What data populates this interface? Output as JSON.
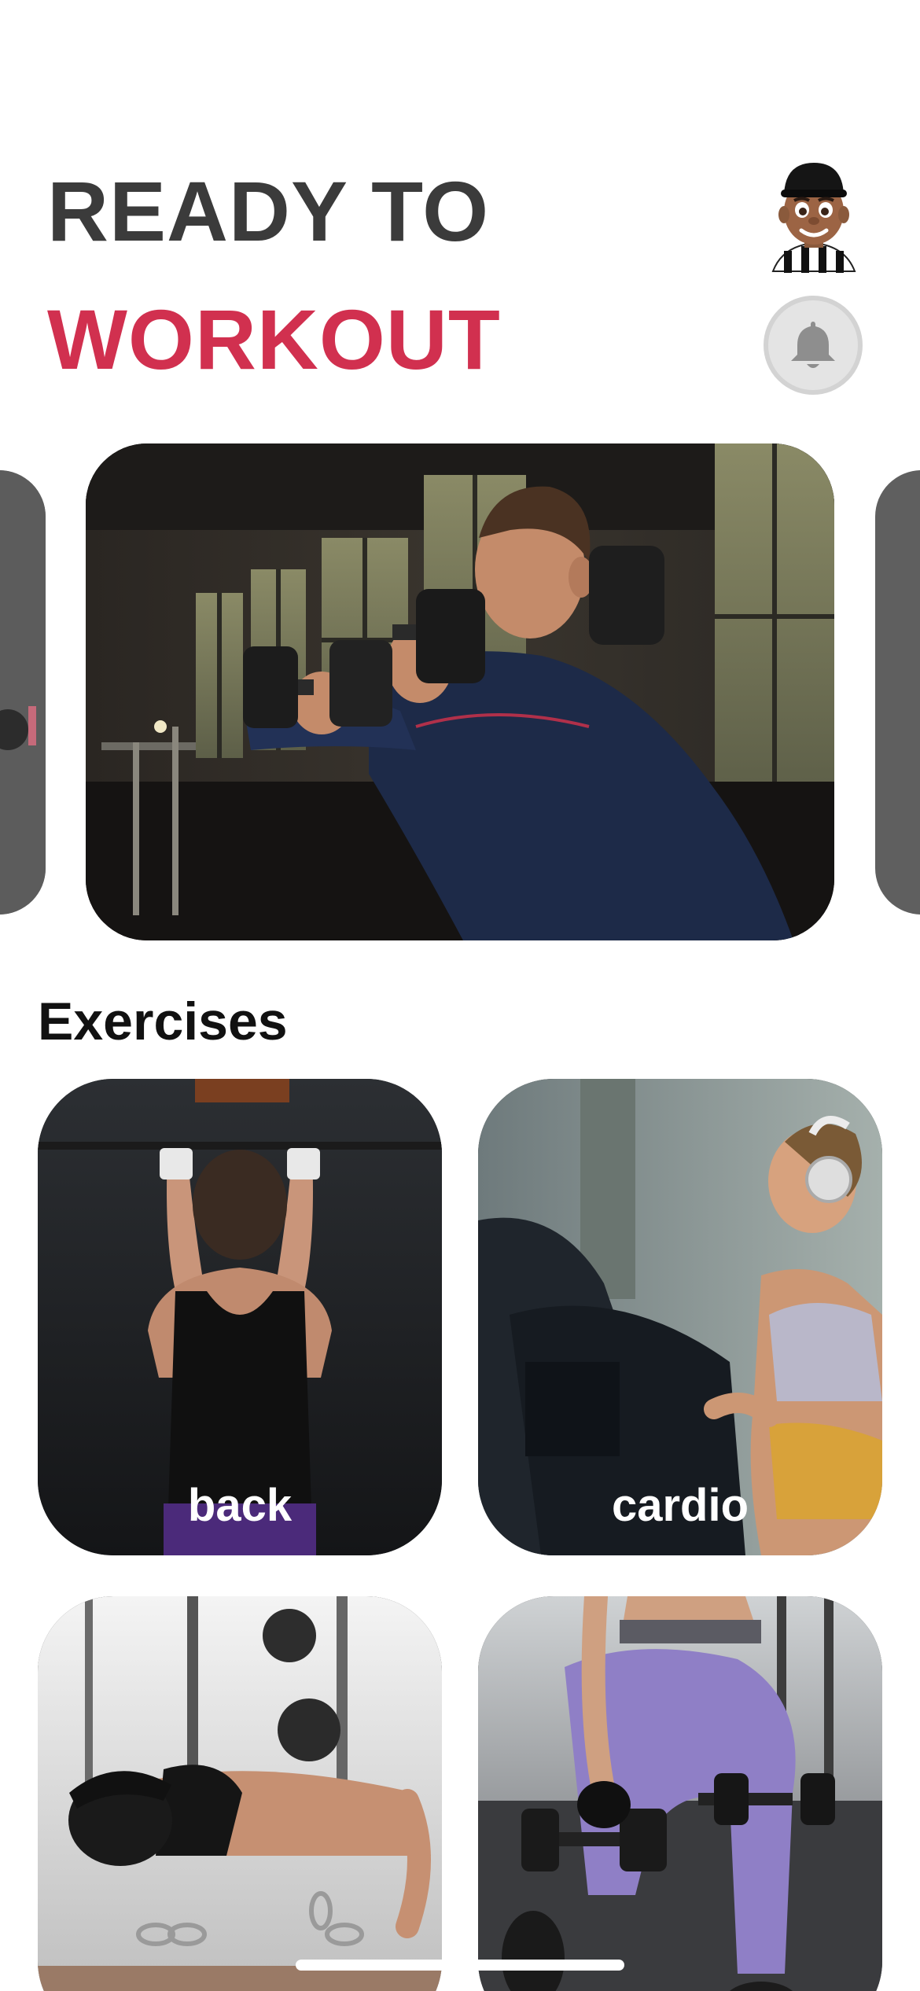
{
  "header": {
    "line1": "READY TO",
    "line2": "WORKOUT",
    "line1_color": "#3b3b3b",
    "accent_color": "#d1304f"
  },
  "avatar": {
    "icon": "referee-avatar-icon"
  },
  "notifications": {
    "icon": "bell-icon"
  },
  "carousel": {
    "featured_image": "man-dumbbell-curl-photo"
  },
  "exercises": {
    "title": "Exercises",
    "items": [
      {
        "label": "back",
        "image": "woman-pull-up-photo"
      },
      {
        "label": "cardio",
        "image": "woman-treadmill-photo"
      },
      {
        "label": "",
        "image": "man-push-up-photo"
      },
      {
        "label": "",
        "image": "woman-lunge-dumbbells-photo"
      }
    ]
  }
}
